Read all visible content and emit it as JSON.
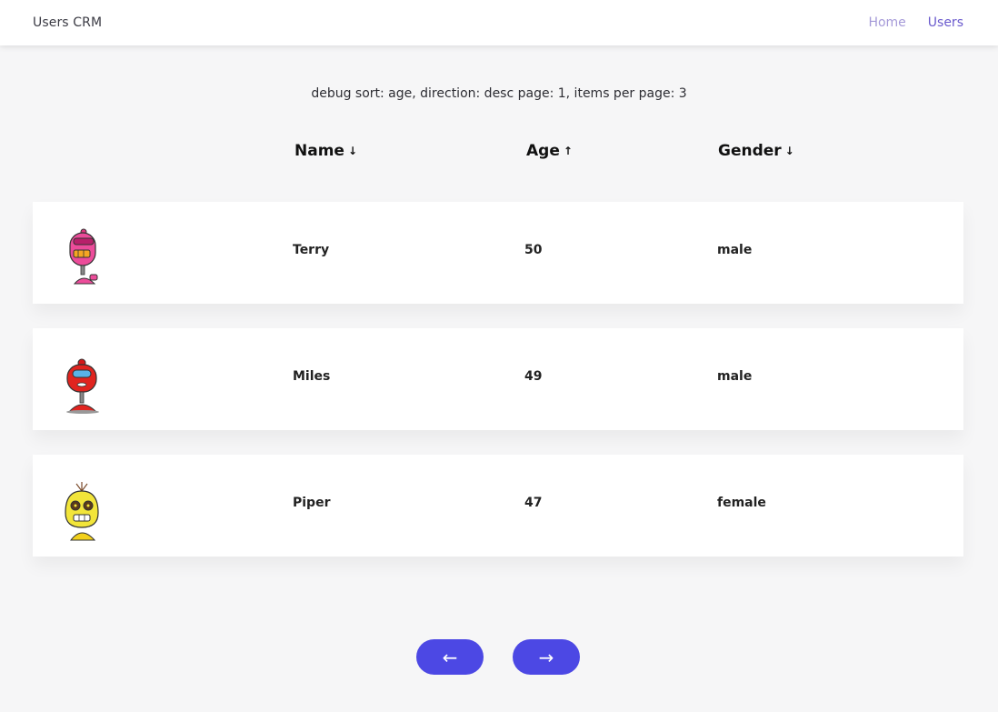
{
  "nav": {
    "brand": "Users CRM",
    "links": [
      {
        "label": "Home",
        "active": false
      },
      {
        "label": "Users",
        "active": true
      }
    ]
  },
  "debug_text": "debug sort: age, direction: desc page: 1, items per page: 3",
  "table": {
    "columns": [
      {
        "label": "Name",
        "sort_arrow": "↓"
      },
      {
        "label": "Age",
        "sort_arrow": "↑"
      },
      {
        "label": "Gender",
        "sort_arrow": "↓"
      }
    ],
    "rows": [
      {
        "name": "Terry",
        "age": "50",
        "gender": "male",
        "avatar": "pink-robot-icon"
      },
      {
        "name": "Miles",
        "age": "49",
        "gender": "male",
        "avatar": "red-robot-icon"
      },
      {
        "name": "Piper",
        "age": "47",
        "gender": "female",
        "avatar": "yellow-robot-icon"
      }
    ]
  },
  "pagination": {
    "prev_label": "←",
    "next_label": "→"
  },
  "colors": {
    "accent": "#4c48e4",
    "nav_active": "#6a5acd",
    "nav_inactive": "#a59ad8",
    "page_bg": "#f6f6f7"
  }
}
